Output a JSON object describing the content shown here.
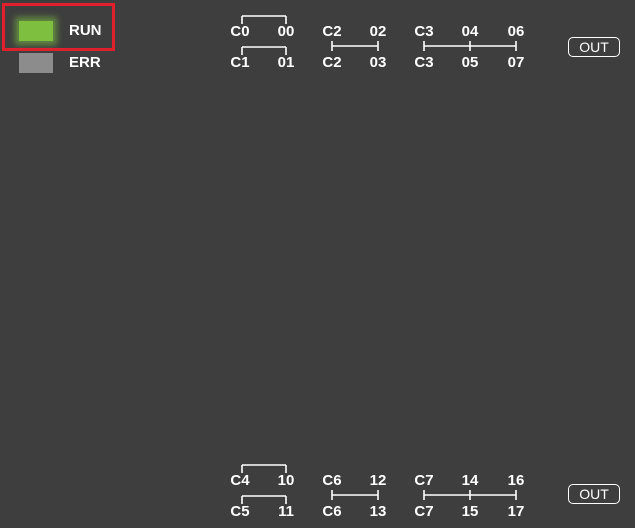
{
  "status": {
    "run": {
      "label": "RUN",
      "color": "#7fbf3f",
      "state": "on"
    },
    "err": {
      "label": "ERR",
      "color": "#8c8c8c",
      "state": "off"
    }
  },
  "top_block": {
    "row1": [
      "C0",
      "00",
      "C2",
      "02",
      "C3",
      "04",
      "06"
    ],
    "row2": [
      "C1",
      "01",
      "C2",
      "03",
      "C3",
      "05",
      "07"
    ],
    "out_label": "OUT"
  },
  "bottom_block": {
    "row1": [
      "C4",
      "10",
      "C6",
      "12",
      "C7",
      "14",
      "16"
    ],
    "row2": [
      "C5",
      "11",
      "C6",
      "13",
      "C7",
      "15",
      "17"
    ],
    "out_label": "OUT"
  }
}
